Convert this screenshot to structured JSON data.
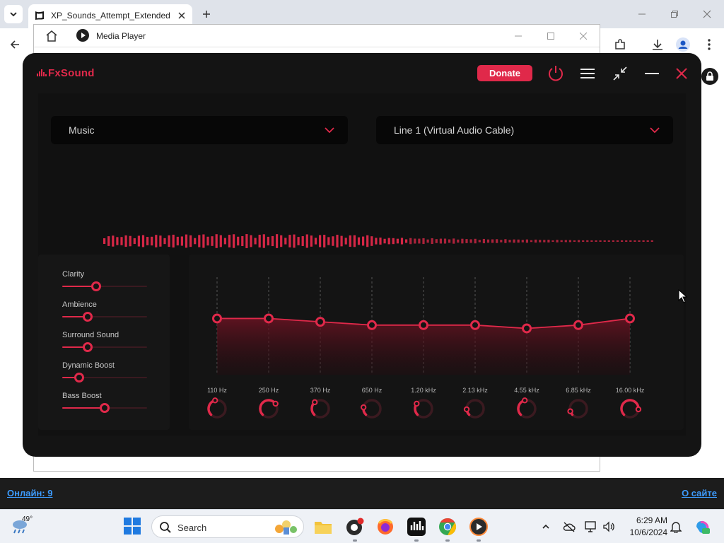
{
  "browser": {
    "tab_title": "XP_Sounds_Attempt_Extended_",
    "popup_title": "Media Player"
  },
  "site": {
    "online_link": "Онлайн: 9",
    "about_link": "О сайте"
  },
  "app": {
    "name": "FxSound",
    "donate_label": "Donate",
    "preset": "Music",
    "output_device": "Line 1 (Virtual Audio Cable)",
    "effects": [
      {
        "label": "Clarity",
        "value": 0.4
      },
      {
        "label": "Ambience",
        "value": 0.3
      },
      {
        "label": "Surround Sound",
        "value": 0.3
      },
      {
        "label": "Dynamic Boost",
        "value": 0.2
      },
      {
        "label": "Bass Boost",
        "value": 0.5
      }
    ],
    "eq_bands": [
      {
        "freq": "110 Hz",
        "level": 0.68
      },
      {
        "freq": "250 Hz",
        "level": 0.68
      },
      {
        "freq": "370 Hz",
        "level": 0.64
      },
      {
        "freq": "650 Hz",
        "level": 0.6
      },
      {
        "freq": "1.20 kHz",
        "level": 0.6
      },
      {
        "freq": "2.13 kHz",
        "level": 0.6
      },
      {
        "freq": "4.55 kHz",
        "level": 0.56
      },
      {
        "freq": "6.85 kHz",
        "level": 0.6
      },
      {
        "freq": "16.00 kHz",
        "level": 0.68
      }
    ],
    "eq_knobs": [
      0.45,
      0.7,
      0.35,
      0.2,
      0.3,
      0.15,
      0.45,
      0.1,
      0.85
    ]
  },
  "taskbar": {
    "weather_temp": "49°",
    "search_label": "Search",
    "time": "6:29 AM",
    "date": "10/6/2024"
  },
  "colors": {
    "accent": "#e0294a",
    "app_bg": "#141414",
    "link": "#3d9cff"
  }
}
